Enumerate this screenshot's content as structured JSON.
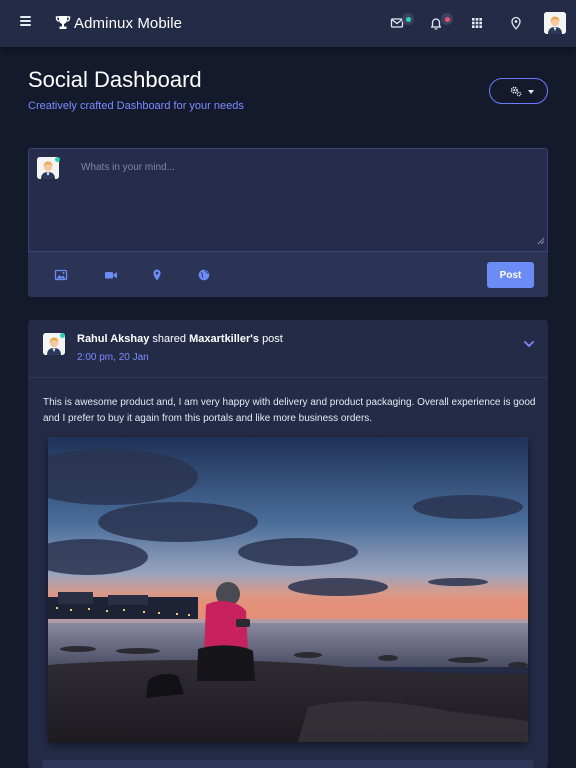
{
  "header": {
    "brand": "Adminux Mobile",
    "icons": [
      "menu-icon",
      "trophy-icon",
      "mail-icon",
      "bell-icon",
      "apps-grid-icon",
      "location-pin-icon"
    ],
    "mail_badge_color": "#2ad3b1",
    "bell_badge_color": "#f0506e"
  },
  "page": {
    "title": "Social Dashboard",
    "subtitle": "Creatively crafted Dashboard for your needs",
    "settings_icon": "gears-icon"
  },
  "composer": {
    "placeholder": "Whats in your mind...",
    "value": "",
    "actions": [
      "image-icon",
      "video-camera-icon",
      "map-marker-icon",
      "globe-icon"
    ],
    "post_label": "Post"
  },
  "post": {
    "author": "Rahul Akshay",
    "action": "shared",
    "target": "Maxartkiller's",
    "object": "post",
    "time": "2:00 pm, 20 Jan",
    "text": "This is awesome product and, I am very happy with delivery and product packaging. Overall experience is good and I prefer to buy it again from this portals and like more business orders."
  },
  "colors": {
    "background": "#141a2b",
    "header": "#242b46",
    "card": "#242b46",
    "accent": "#7c8cff",
    "post_button": "#6b8cf5"
  }
}
